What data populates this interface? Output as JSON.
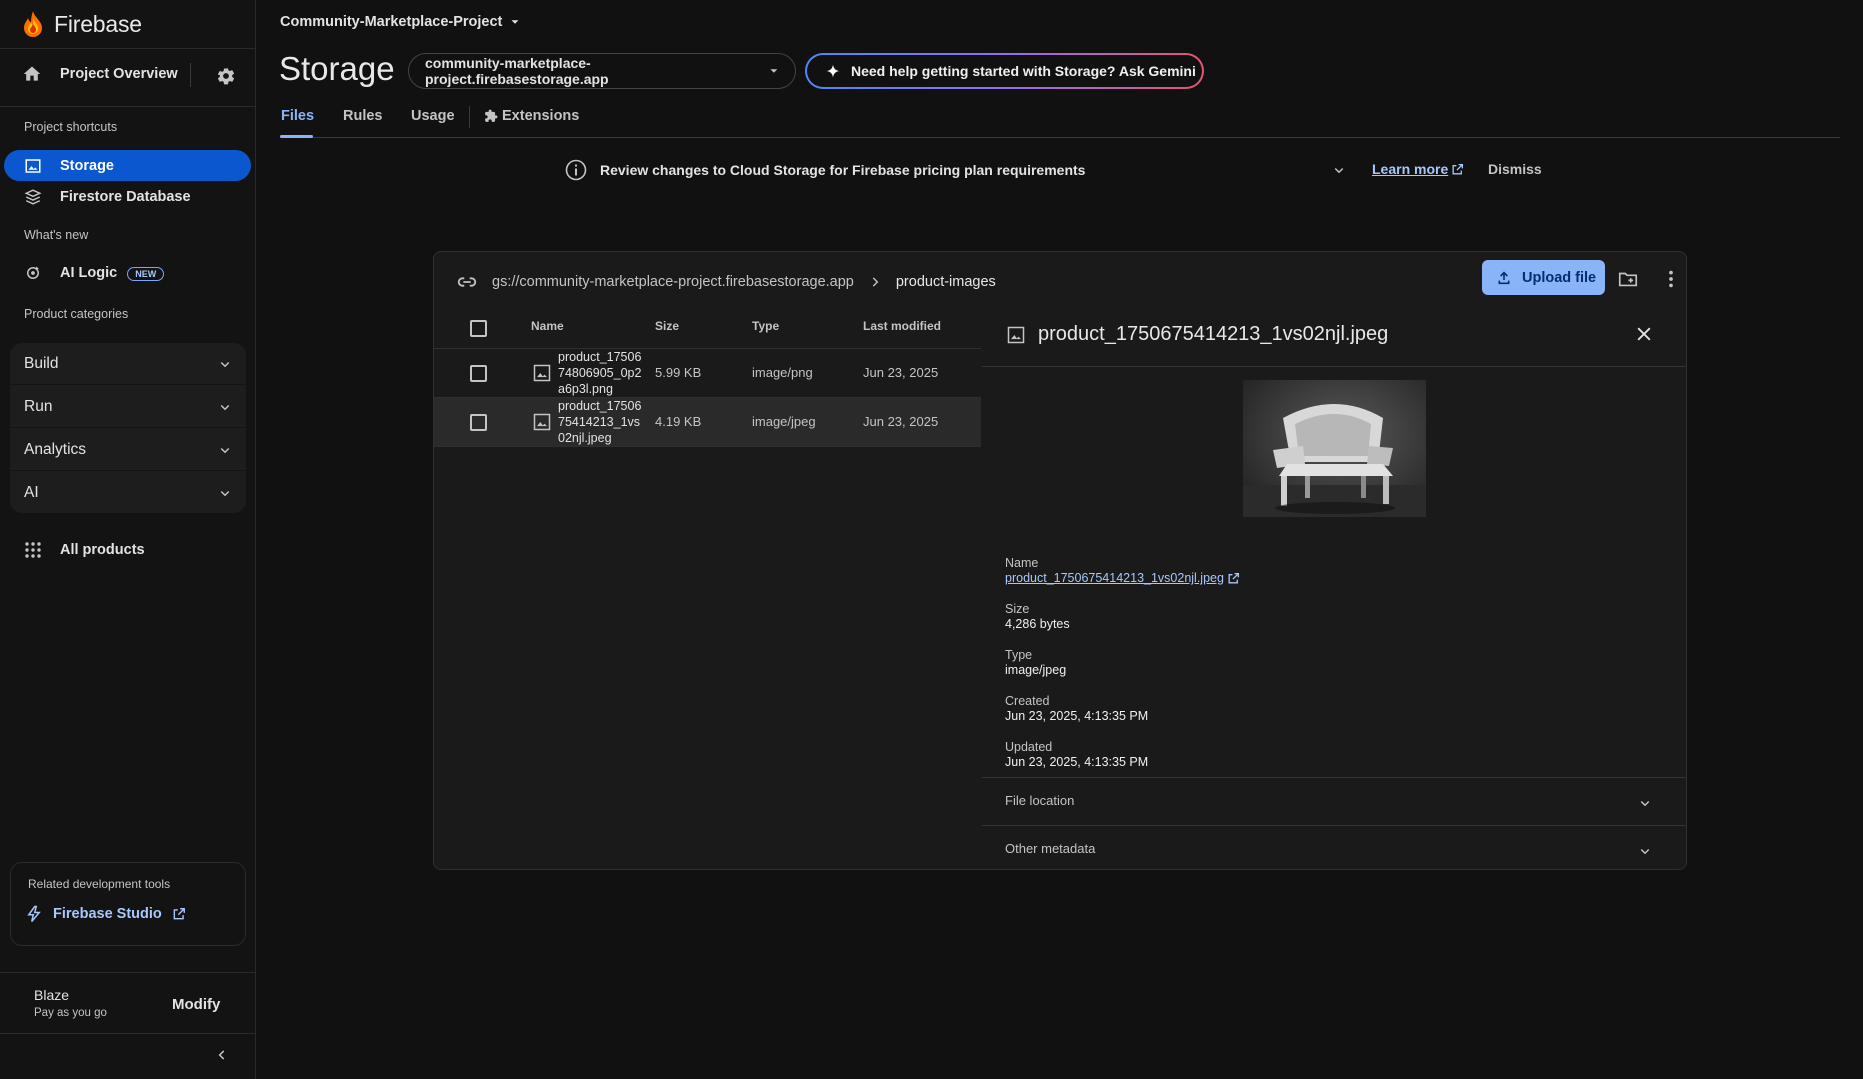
{
  "brand": {
    "name": "Firebase"
  },
  "sidebar": {
    "project_overview": "Project Overview",
    "shortcuts_label": "Project shortcuts",
    "shortcuts": [
      {
        "label": "Storage",
        "icon": "image-icon",
        "active": true
      },
      {
        "label": "Firestore Database",
        "icon": "firestore-icon",
        "active": false
      }
    ],
    "whats_new_label": "What's new",
    "ai_logic": {
      "label": "AI Logic",
      "badge": "NEW"
    },
    "categories_label": "Product categories",
    "categories": [
      {
        "label": "Build"
      },
      {
        "label": "Run"
      },
      {
        "label": "Analytics"
      },
      {
        "label": "AI"
      }
    ],
    "all_products": "All products",
    "related_tools": {
      "title": "Related development tools",
      "studio": "Firebase Studio"
    },
    "plan": {
      "name": "Blaze",
      "subtitle": "Pay as you go",
      "modify": "Modify"
    }
  },
  "header": {
    "project": "Community-Marketplace-Project",
    "title": "Storage",
    "bucket": "community-marketplace-project.firebasestorage.app",
    "gemini": "Need help getting started with Storage? Ask Gemini"
  },
  "tabs": [
    {
      "label": "Files",
      "active": true
    },
    {
      "label": "Rules",
      "active": false
    },
    {
      "label": "Usage",
      "active": false
    },
    {
      "label": "Extensions",
      "active": false
    }
  ],
  "banner": {
    "text": "Review changes to Cloud Storage for Firebase pricing plan requirements",
    "learn_more": "Learn more",
    "dismiss": "Dismiss"
  },
  "browser": {
    "path_root": "gs://community-marketplace-project.firebasestorage.app",
    "path_current": "product-images",
    "upload_label": "Upload file",
    "columns": {
      "name": "Name",
      "size": "Size",
      "type": "Type",
      "modified": "Last modified"
    },
    "rows": [
      {
        "name": "product_1750674806905_0p2a6p3l.png",
        "size": "5.99 KB",
        "type": "image/png",
        "modified": "Jun 23, 2025"
      },
      {
        "name": "product_1750675414213_1vs02njl.jpeg",
        "size": "4.19 KB",
        "type": "image/jpeg",
        "modified": "Jun 23, 2025"
      }
    ]
  },
  "detail": {
    "title": "product_1750675414213_1vs02njl.jpeg",
    "name_label": "Name",
    "name_value": "product_1750675414213_1vs02njl.jpeg",
    "size_label": "Size",
    "size_value": "4,286 bytes",
    "type_label": "Type",
    "type_value": "image/jpeg",
    "created_label": "Created",
    "created_value": "Jun 23, 2025, 4:13:35 PM",
    "updated_label": "Updated",
    "updated_value": "Jun 23, 2025, 4:13:35 PM",
    "file_location": "File location",
    "other_metadata": "Other metadata"
  },
  "colors": {
    "accent": "#8ab4f8",
    "active_nav": "#0b57d0",
    "background": "#111111",
    "panel": "#1a1a1a"
  }
}
